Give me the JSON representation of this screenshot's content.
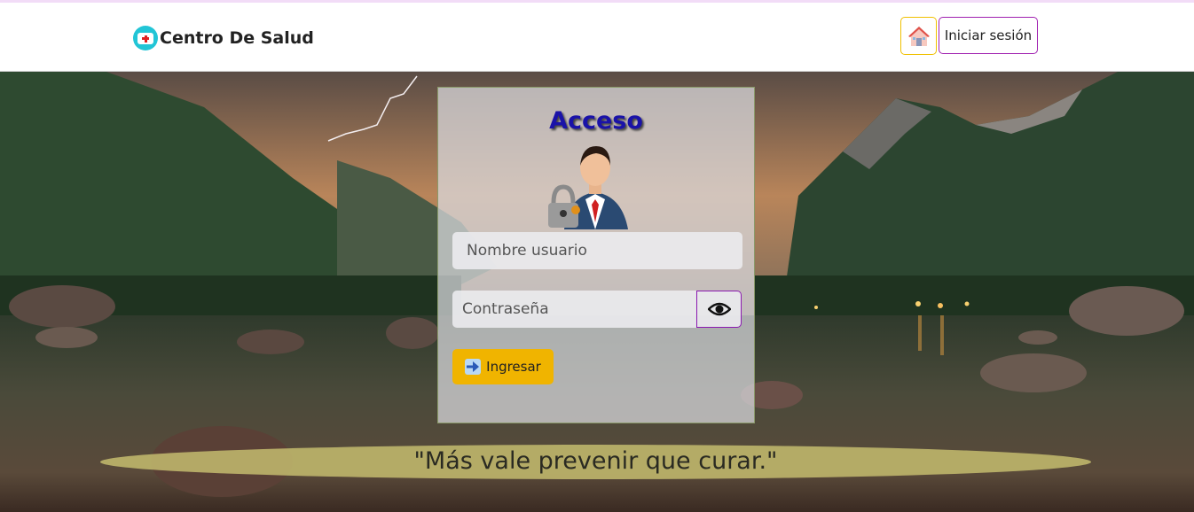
{
  "header": {
    "brand_title": "Centro De Salud",
    "brand_icon": "medical-kit-icon",
    "home_icon": "house-icon",
    "login_label": "Iniciar sesión"
  },
  "login_card": {
    "title": "Acceso",
    "avatar_icon": "user-lock-avatar-icon",
    "username_placeholder": "Nombre usuario",
    "password_placeholder": "Contraseña",
    "toggle_password_icon": "eye-icon",
    "submit_label": "Ingresar",
    "submit_icon": "arrow-right-icon"
  },
  "motto": "\"Más vale prevenir que curar.\"",
  "colors": {
    "title_blue": "#1a12a8",
    "submit_yellow": "#f0b400",
    "login_border": "#a020b0",
    "home_border": "#f0c000",
    "motto_band": "#c4bc6e"
  }
}
